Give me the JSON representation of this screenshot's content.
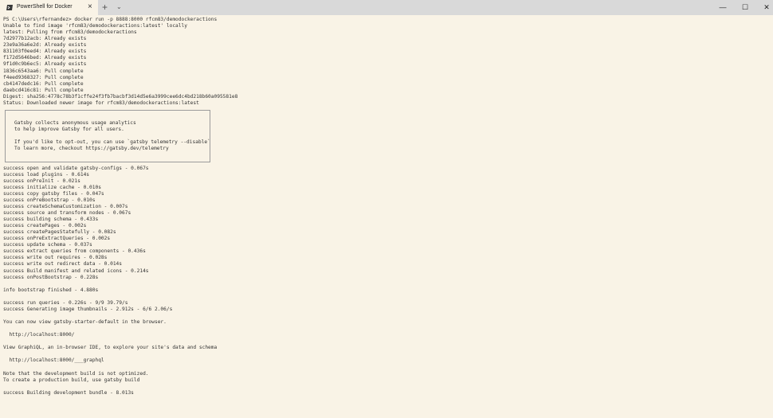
{
  "window": {
    "tab_title": "PowerShell for Docker",
    "new_tab_label": "+",
    "dropdown_label": "⌄",
    "close_tab_label": "×",
    "minimize_label": "—",
    "maximize_label": "☐",
    "close_label": "✕"
  },
  "terminal": {
    "lines_top": [
      "PS C:\\Users\\rfernandez> docker run -p 8888:8000 rfcm83/demodockeractions",
      "Unable to find image 'rfcm83/demodockeractions:latest' locally",
      "latest: Pulling from rfcm83/demodockeractions",
      "7d2977b12acb: Already exists",
      "23e9a36a6e2d: Already exists",
      "831103f0eed4: Already exists",
      "f172d5646bed: Already exists",
      "9f1d0c9b6ec5: Already exists",
      "1836c6543aa6: Pull complete",
      "f4eed9368327: Pull complete",
      "cb4147dedc16: Pull complete",
      "daebcd416c81: Pull complete",
      "Digest: sha256:4778c78b3f1cffe24f3fb7bacbf3d14d5e6a3999cee6dc4bd218b60a095581e8",
      "Status: Downloaded newer image for rfcm83/demodockeractions:latest"
    ],
    "notice_lines": [
      "Gatsby collects anonymous usage analytics",
      "to help improve Gatsby for all users.",
      "",
      "If you'd like to opt-out, you can use `gatsby telemetry --disable`",
      "To learn more, checkout https://gatsby.dev/telemetry"
    ],
    "lines_bottom": [
      "success open and validate gatsby-configs - 0.067s",
      "success load plugins - 0.614s",
      "success onPreInit - 0.021s",
      "success initialize cache - 0.010s",
      "success copy gatsby files - 0.047s",
      "success onPreBootstrap - 0.010s",
      "success createSchemaCustomization - 0.007s",
      "success source and transform nodes - 0.067s",
      "success building schema - 0.433s",
      "success createPages - 0.002s",
      "success createPagesStatefully - 0.082s",
      "success onPreExtractQueries - 0.002s",
      "success update schema - 0.037s",
      "success extract queries from components - 0.436s",
      "success write out requires - 0.028s",
      "success write out redirect data - 0.014s",
      "success Build manifest and related icons - 0.214s",
      "success onPostBootstrap - 0.228s",
      "",
      "info bootstrap finished - 4.880s",
      "",
      "success run queries - 0.226s - 9/9 39.79/s",
      "success Generating image thumbnails - 2.912s - 6/6 2.06/s",
      "",
      "You can now view gatsby-starter-default in the browser.",
      "",
      "  http://localhost:8000/",
      "",
      "View GraphiQL, an in-browser IDE, to explore your site's data and schema",
      "",
      "  http://localhost:8000/___graphql",
      "",
      "Note that the development build is not optimized.",
      "To create a production build, use gatsby build",
      "",
      "success Building development bundle - 8.013s"
    ]
  }
}
